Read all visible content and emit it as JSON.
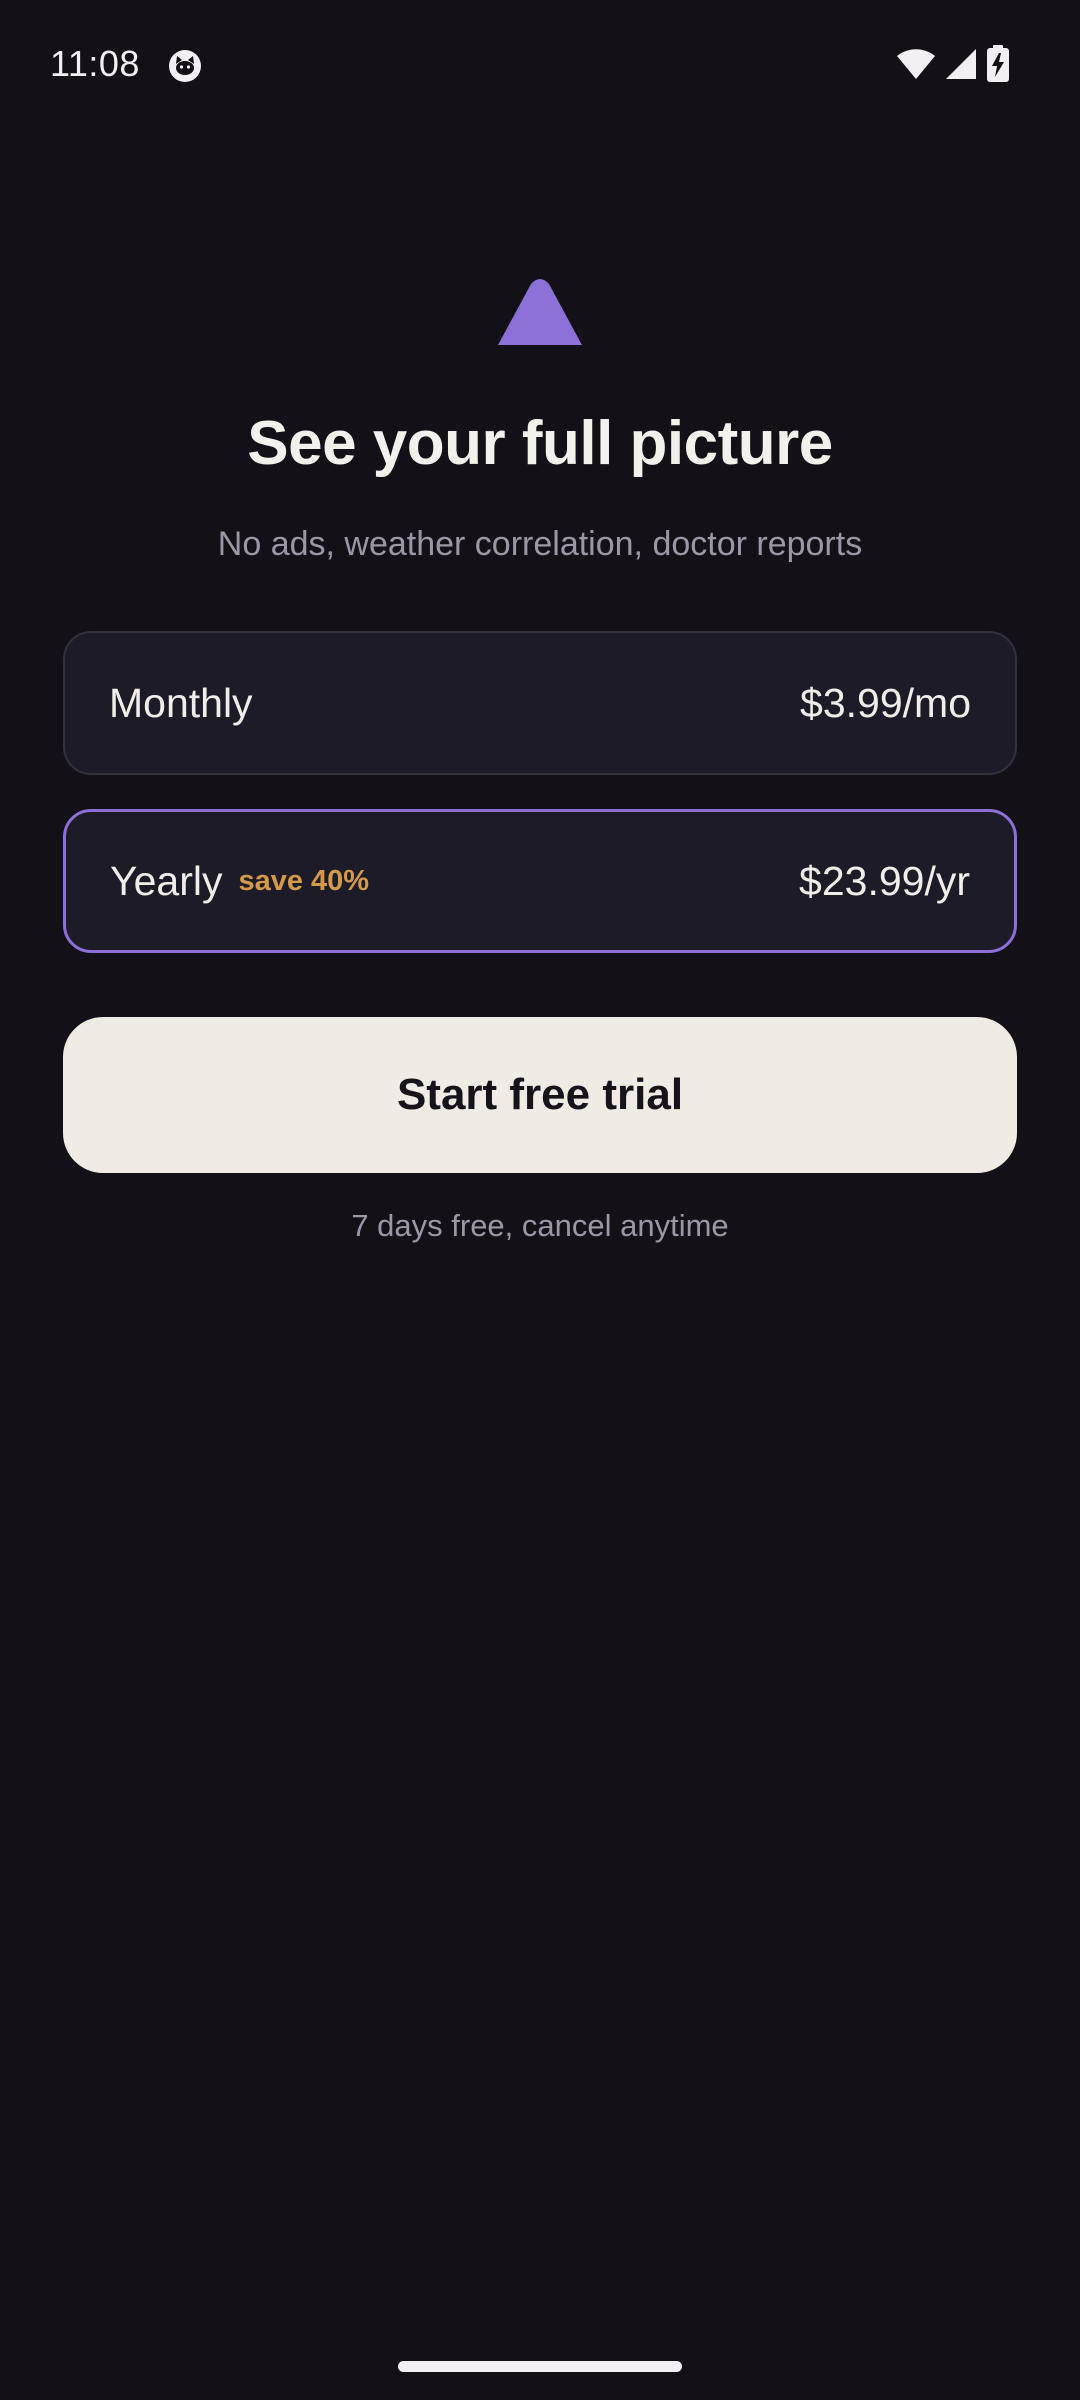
{
  "status_bar": {
    "time": "11:08",
    "app_icon": "cat-face-icon",
    "icons": [
      "wifi-icon",
      "cellular-signal-icon",
      "battery-charging-icon"
    ]
  },
  "logo": {
    "icon": "purple-triangle-logo",
    "color": "#8d6fd8"
  },
  "header": {
    "title": "See your full picture",
    "subtitle": "No ads, weather correlation, doctor reports"
  },
  "plans": [
    {
      "name": "Monthly",
      "badge": "",
      "price": "$3.99/mo",
      "selected": false
    },
    {
      "name": "Yearly",
      "badge": "save 40%",
      "price": "$23.99/yr",
      "selected": true
    }
  ],
  "cta": {
    "label": "Start free trial"
  },
  "footer": {
    "note": "7 days free, cancel anytime"
  },
  "colors": {
    "background": "#131017",
    "accent": "#8d6fd8",
    "badge": "#d49a4b",
    "card": "#1e1b29",
    "cta_background": "#f0ebe4"
  }
}
